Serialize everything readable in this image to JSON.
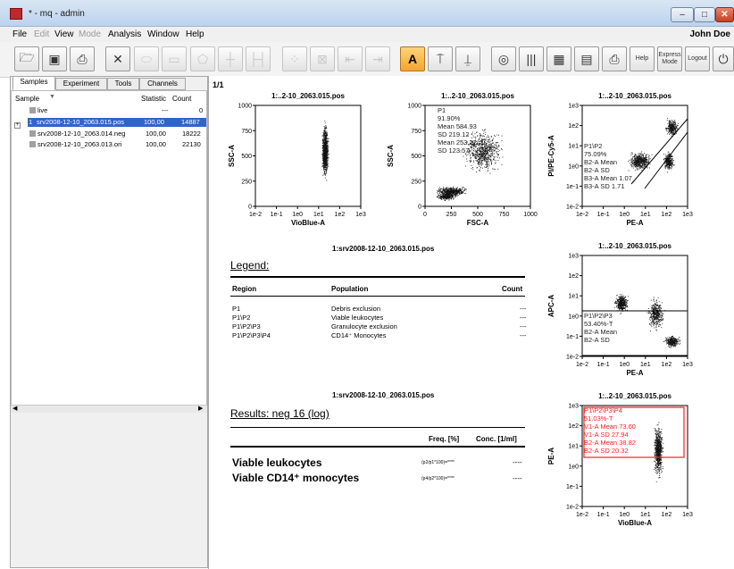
{
  "window": {
    "title": "* - mq - admin",
    "user": "John Doe"
  },
  "menu": [
    {
      "label": "File",
      "enabled": true
    },
    {
      "label": "Edit",
      "enabled": false
    },
    {
      "label": "View",
      "enabled": true
    },
    {
      "label": "Mode",
      "enabled": false
    },
    {
      "label": "Analysis",
      "enabled": true
    },
    {
      "label": "Window",
      "enabled": true
    },
    {
      "label": "Help",
      "enabled": true
    }
  ],
  "toolbar": {
    "help_label": "Help",
    "express_label": "Express Mode",
    "logout_label": "Logout"
  },
  "tabs": [
    "Samples",
    "Experiment",
    "Tools",
    "Channels"
  ],
  "sample_table": {
    "headers": [
      "Sample",
      "Statistic",
      "Count"
    ],
    "rows": [
      {
        "name": "live",
        "statistic": "---",
        "count": "0",
        "selected": false
      },
      {
        "name": "srv2008-12-10_2063.015.pos",
        "statistic": "100,00",
        "count": "14887",
        "selected": true,
        "index": "1"
      },
      {
        "name": "srv2008-12-10_2063.014.neg",
        "statistic": "100,00",
        "count": "18222",
        "selected": false
      },
      {
        "name": "srv2008-12-10_2063.013.ori",
        "statistic": "100,00",
        "count": "22130",
        "selected": false
      }
    ]
  },
  "page_label": "1/1",
  "plots": [
    {
      "title": "1:..2-10_2063.015.pos",
      "xlabel": "VioBlue-A",
      "ylabel": "SSC-A",
      "xticks": [
        "1e-2",
        "1e-1",
        "1e0",
        "1e1",
        "1e2",
        "1e3"
      ],
      "yticks": [
        "1000",
        "750",
        "500",
        "250",
        "0"
      ],
      "gate_text": []
    },
    {
      "title": "1:..2-10_2063.015.pos",
      "xlabel": "FSC-A",
      "ylabel": "SSC-A",
      "xticks": [
        "0",
        "250",
        "500",
        "750",
        "1000"
      ],
      "yticks": [
        "1000",
        "750",
        "500",
        "250",
        "0"
      ],
      "gate_text": [
        "P1",
        "91.90%",
        "Mean 584.93",
        "SD 219.12",
        "Mean 253.22",
        "SD 123.57"
      ]
    },
    {
      "title": "1:..2-10_2063.015.pos",
      "xlabel": "PE-A",
      "ylabel": "PI/PE-Cy5-A",
      "xticks": [
        "1e-2",
        "1e-1",
        "1e0",
        "1e1",
        "1e2",
        "1e3"
      ],
      "yticks": [
        "1e3",
        "1e2",
        "1e1",
        "1e0",
        "1e-1",
        "1e-2"
      ],
      "gate_text": [
        "P1\\P2",
        "75.09%",
        "B2-A Mean",
        "B2-A SD",
        "B3-A Mean 1.07",
        "B3-A SD 1.71"
      ]
    },
    {
      "title": "1:..2-10_2063.015.pos",
      "xlabel": "PE-A",
      "ylabel": "APC-A",
      "xticks": [
        "1e-2",
        "1e-1",
        "1e0",
        "1e1",
        "1e2",
        "1e3"
      ],
      "yticks": [
        "1e3",
        "1e2",
        "1e1",
        "1e0",
        "1e-1",
        "1e-2"
      ],
      "gate_text": [
        "P1\\P2\\P3",
        "53.40%-T",
        "B2-A Mean",
        "B2-A SD"
      ]
    },
    {
      "title": "1:..2-10_2063.015.pos",
      "xlabel": "VioBlue-A",
      "ylabel": "PE-A",
      "xticks": [
        "1e-2",
        "1e-1",
        "1e0",
        "1e1",
        "1e2",
        "1e3"
      ],
      "yticks": [
        "1e3",
        "1e2",
        "1e1",
        "1e0",
        "1e-1",
        "1e-2"
      ],
      "gate_text": [
        "P1\\P2\\P3\\P4",
        "51.03%-T",
        "V1-A Mean 73.60",
        "V1-A SD 27.94",
        "B2-A Mean 38.82",
        "B2-A SD 20.32"
      ]
    }
  ],
  "legend": {
    "file": "1:srv2008-12-10_2063.015.pos",
    "heading": "Legend:",
    "headers": [
      "Region",
      "Population",
      "Count"
    ],
    "rows": [
      [
        "P1",
        "Debris exclusion",
        "---"
      ],
      [
        "P1\\P2",
        "Viable leukocytes",
        "---"
      ],
      [
        "P1\\P2\\P3",
        "Granulocyte exclusion",
        "---"
      ],
      [
        "P1\\P2\\P3\\P4",
        "CD14⁺ Monocytes",
        "---"
      ]
    ]
  },
  "results": {
    "file": "1:srv2008-12-10_2063.015.pos",
    "heading": "Results: neg 16 (log)",
    "headers": [
      "Freq. [%]",
      "Conc. [1/ml]"
    ],
    "rows": [
      [
        "Viable leukocytes",
        "(p2/p1*100)=****",
        "----"
      ],
      [
        "Viable CD14⁺ monocytes",
        "(p4/p2*100)=****",
        "----"
      ]
    ]
  },
  "colors": {
    "accent_gate": "#ff2020",
    "selection": "#3064c8"
  }
}
